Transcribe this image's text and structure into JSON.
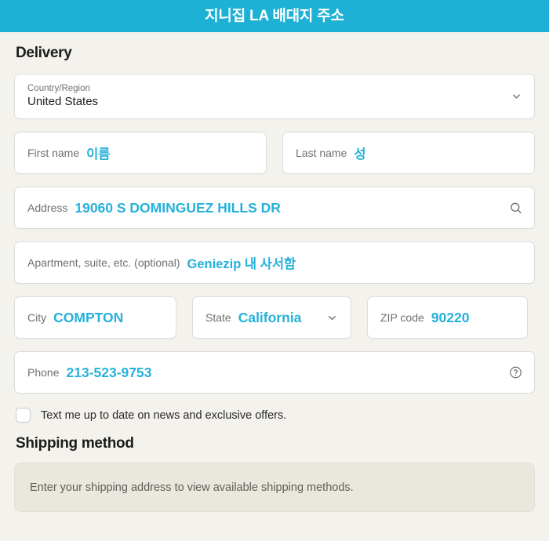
{
  "titlebar": {
    "title": "지니집 LA 배대지 주소",
    "background_color": "#1eb1d6",
    "text_color": "#ffffff"
  },
  "theme": {
    "page_background": "#f4f2ec",
    "accent_color": "#25b1da",
    "field_background": "#ffffff",
    "field_border": "#dcdcdc",
    "label_color": "#6f6f6f",
    "notice_background": "#eae7de"
  },
  "delivery": {
    "heading": "Delivery",
    "country": {
      "label": "Country/Region",
      "value": "United States",
      "icon": "chevron-down-icon"
    },
    "first_name": {
      "label": "First name",
      "value": "이름"
    },
    "last_name": {
      "label": "Last name",
      "value": "성"
    },
    "address": {
      "label": "Address",
      "value": "19060 S DOMINGUEZ HILLS DR",
      "icon": "search-icon"
    },
    "apartment": {
      "label": "Apartment, suite, etc. (optional)",
      "value": "Geniezip 내 사서함"
    },
    "city": {
      "label": "City",
      "value": "COMPTON"
    },
    "state": {
      "label": "State",
      "value": "California",
      "icon": "chevron-down-icon"
    },
    "zip": {
      "label": "ZIP code",
      "value": "90220"
    },
    "phone": {
      "label": "Phone",
      "value": "213-523-9753",
      "icon": "help-circle-icon"
    },
    "marketing_optin": {
      "label": "Text me up to date on news and exclusive offers.",
      "checked": false
    }
  },
  "shipping": {
    "heading": "Shipping method",
    "notice": "Enter your shipping address to view available shipping methods."
  }
}
